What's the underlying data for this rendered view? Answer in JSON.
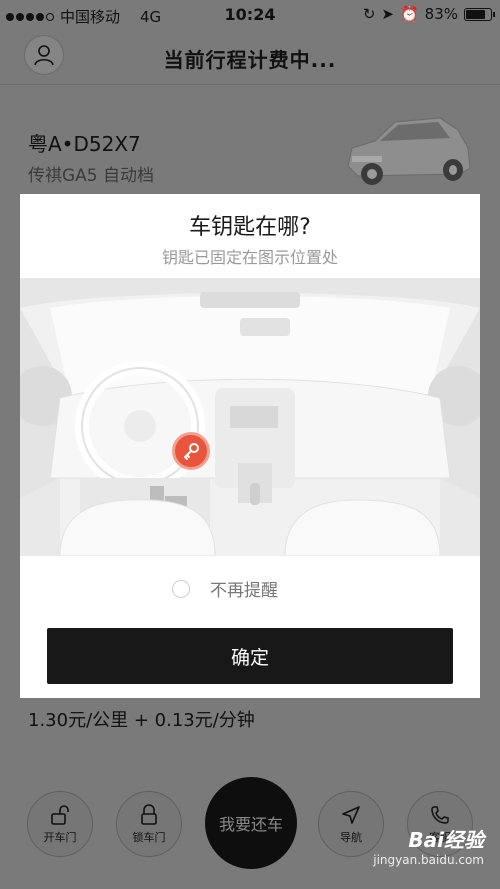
{
  "status_bar": {
    "carrier": "中国移动",
    "network": "4G",
    "time": "10:24",
    "battery": "83%",
    "battery_level": 0.83
  },
  "header": {
    "title": "当前行程计费中..."
  },
  "car": {
    "plate": "粤A•D52X7",
    "model": "传祺GA5 自动档"
  },
  "modal": {
    "title": "车钥匙在哪?",
    "subtitle": "钥匙已固定在图示位置处",
    "remind_label": "不再提醒",
    "confirm_label": "确定"
  },
  "pricing": {
    "rate": "1.30元/公里 + 0.13元/分钟"
  },
  "actions": {
    "unlock_label": "开车门",
    "lock_label": "锁车门",
    "return_label": "我要还车",
    "navigate_label": "导航",
    "service_label": "客服"
  },
  "watermark": {
    "brand": "Bai经验",
    "url": "jingyan.baidu.com"
  },
  "colors": {
    "overlay": "#7a7a7a",
    "key_accent": "#e8553c",
    "confirm_button": "#181818"
  }
}
